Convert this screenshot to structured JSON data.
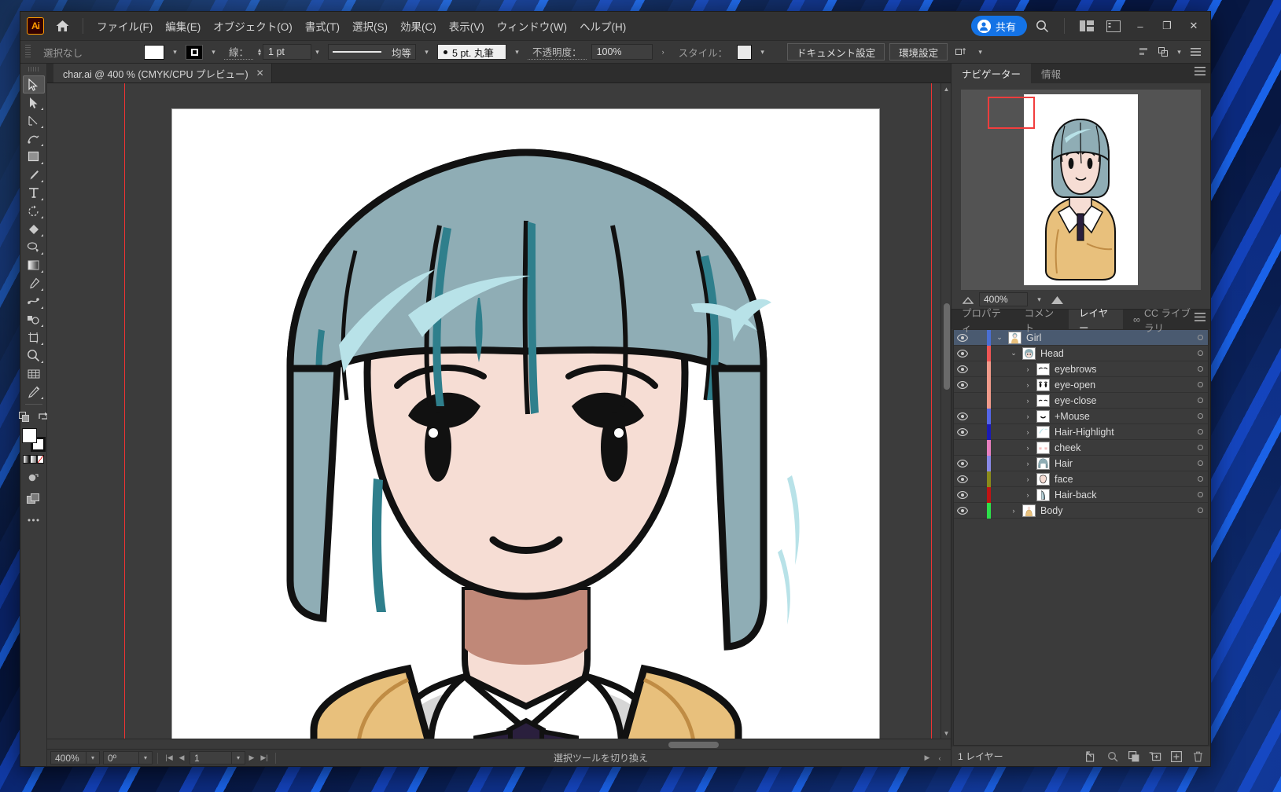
{
  "app": {
    "logo_text": "Ai",
    "home_icon": "home-icon"
  },
  "menubar": {
    "items": [
      {
        "label": "ファイル(F)"
      },
      {
        "label": "編集(E)"
      },
      {
        "label": "オブジェクト(O)"
      },
      {
        "label": "書式(T)"
      },
      {
        "label": "選択(S)"
      },
      {
        "label": "効果(C)"
      },
      {
        "label": "表示(V)"
      },
      {
        "label": "ウィンドウ(W)"
      },
      {
        "label": "ヘルプ(H)"
      }
    ],
    "share_label": "共有",
    "search_icon": "search-icon",
    "workspace_icon": "workspace-switcher-icon",
    "panels_icon": "panel-toggle-icon",
    "minimize": "–",
    "maximize": "❐",
    "close": "✕"
  },
  "controlbar": {
    "selection_status": "選択なし",
    "fill_swatch_color": "#ffffff",
    "stroke_swatch_color": "#000000",
    "stroke_label": "線：",
    "stroke_weight": "1 pt",
    "stroke_profile": "均等",
    "brush_label": "5 pt. 丸筆",
    "opacity_label": "不透明度：",
    "opacity_value": "100%",
    "opacity_arrow": "›",
    "style_label": "スタイル：",
    "style_swatch_color": "#e9e9e9",
    "document_setup": "ドキュメント設定",
    "preferences": "環境設定",
    "align_icon": "align-icon",
    "arrange_icon": "arrange-icon",
    "transform_icon": "transform-icon",
    "options_icon": "panel-options-icon"
  },
  "tools": [
    {
      "name": "selection-tool",
      "active": true
    },
    {
      "name": "direct-selection-tool",
      "active": false
    },
    {
      "name": "pen-tool",
      "active": false
    },
    {
      "name": "curvature-tool",
      "active": false
    },
    {
      "name": "rectangle-tool",
      "active": false
    },
    {
      "name": "paintbrush-tool",
      "active": false
    },
    {
      "name": "type-tool",
      "active": false
    },
    {
      "name": "rotate-tool",
      "active": false
    },
    {
      "name": "shape-builder-tool",
      "active": false
    },
    {
      "name": "lasso-tool",
      "active": false
    },
    {
      "name": "gradient-tool",
      "active": false
    },
    {
      "name": "eyedropper-tool",
      "active": false
    },
    {
      "name": "blend-tool",
      "active": false
    },
    {
      "name": "symbol-sprayer-tool",
      "active": false
    },
    {
      "name": "artboard-tool",
      "active": false
    },
    {
      "name": "zoom-tool",
      "active": false
    },
    {
      "name": "perspective-grid-tool",
      "active": false
    },
    {
      "name": "measure-tool",
      "active": false
    }
  ],
  "document": {
    "tab_title": "char.ai @ 400 % (CMYK/CPU プレビュー)",
    "tab_close": "✕"
  },
  "statusbar": {
    "zoom": "400%",
    "rotation": "0º",
    "artboard_number": "1",
    "tool_hint": "選択ツールを切り換え",
    "first_icon": "first-artboard-icon",
    "prev_icon": "prev-artboard-icon",
    "next_icon": "next-artboard-icon",
    "last_icon": "last-artboard-icon",
    "play_icon": "status-menu-icon",
    "resize_icon": "resize-grip-icon"
  },
  "navigator": {
    "tabs": [
      {
        "label": "ナビゲーター",
        "active": true
      },
      {
        "label": "情報",
        "active": false
      }
    ],
    "zoom_value": "400%",
    "zoom_out_icon": "zoom-out-icon",
    "zoom_in_icon": "zoom-in-icon",
    "menu_icon": "panel-menu-icon"
  },
  "layers_panel": {
    "tabs": [
      {
        "label": "プロパティ",
        "active": false
      },
      {
        "label": "コメント",
        "active": false
      },
      {
        "label": "レイヤー",
        "active": true
      },
      {
        "label": "CC ライブラリ",
        "active": false
      }
    ],
    "menu_icon": "panel-menu-icon",
    "rows": [
      {
        "name": "Girl",
        "indent": 0,
        "visible": true,
        "color": "#4a6fd4",
        "selected": true,
        "twist": "down",
        "thumb": "girl"
      },
      {
        "name": "Head",
        "indent": 1,
        "visible": true,
        "color": "#ef5555",
        "selected": false,
        "twist": "down",
        "thumb": "head"
      },
      {
        "name": "eyebrows",
        "indent": 2,
        "visible": true,
        "color": "#f09a8a",
        "selected": false,
        "twist": "right",
        "thumb": "eyebrows"
      },
      {
        "name": "eye-open",
        "indent": 2,
        "visible": true,
        "color": "#f09a8a",
        "selected": false,
        "twist": "right",
        "thumb": "eyeopen"
      },
      {
        "name": "eye-close",
        "indent": 2,
        "visible": false,
        "color": "#f09a8a",
        "selected": false,
        "twist": "right",
        "thumb": "eyeclose"
      },
      {
        "name": "+Mouse",
        "indent": 2,
        "visible": true,
        "color": "#5566e8",
        "selected": false,
        "twist": "right",
        "thumb": "mouth"
      },
      {
        "name": "Hair-Highlight",
        "indent": 2,
        "visible": true,
        "color": "#1a1ab5",
        "selected": false,
        "twist": "right",
        "thumb": "highlight"
      },
      {
        "name": "cheek",
        "indent": 2,
        "visible": false,
        "color": "#e87fc0",
        "selected": false,
        "twist": "right",
        "thumb": "cheek"
      },
      {
        "name": "Hair",
        "indent": 2,
        "visible": true,
        "color": "#8a8ae8",
        "selected": false,
        "twist": "right",
        "thumb": "hair"
      },
      {
        "name": "face",
        "indent": 2,
        "visible": true,
        "color": "#8a8a1a",
        "selected": false,
        "twist": "right",
        "thumb": "face"
      },
      {
        "name": "Hair-back",
        "indent": 2,
        "visible": true,
        "color": "#c01414",
        "selected": false,
        "twist": "right",
        "thumb": "hairback"
      },
      {
        "name": "Body",
        "indent": 1,
        "visible": true,
        "color": "#2de04a",
        "selected": false,
        "twist": "right",
        "thumb": "body"
      }
    ],
    "footer_count": "1 レイヤー",
    "footer_icons": [
      {
        "name": "locate-object-icon"
      },
      {
        "name": "search-layer-icon"
      },
      {
        "name": "make-clipping-mask-icon"
      },
      {
        "name": "new-sublayer-icon"
      },
      {
        "name": "new-layer-icon"
      },
      {
        "name": "delete-layer-icon"
      }
    ]
  },
  "artwork": {
    "title": "anime girl character illustration",
    "colors": {
      "hair": "#8fadb5",
      "hair_shadow": "#2f7f8c",
      "hair_highlight": "#b8e2e8",
      "skin": "#f6ddd4",
      "neck_shadow": "#c08878",
      "outline": "#111111",
      "sweater": "#e8c07c",
      "sweater_shade": "#c08c44",
      "shirt": "#ffffff",
      "shirt_shade": "#cfcfcf",
      "ribbon": "#2a1f3d",
      "eye": "#151515"
    }
  }
}
